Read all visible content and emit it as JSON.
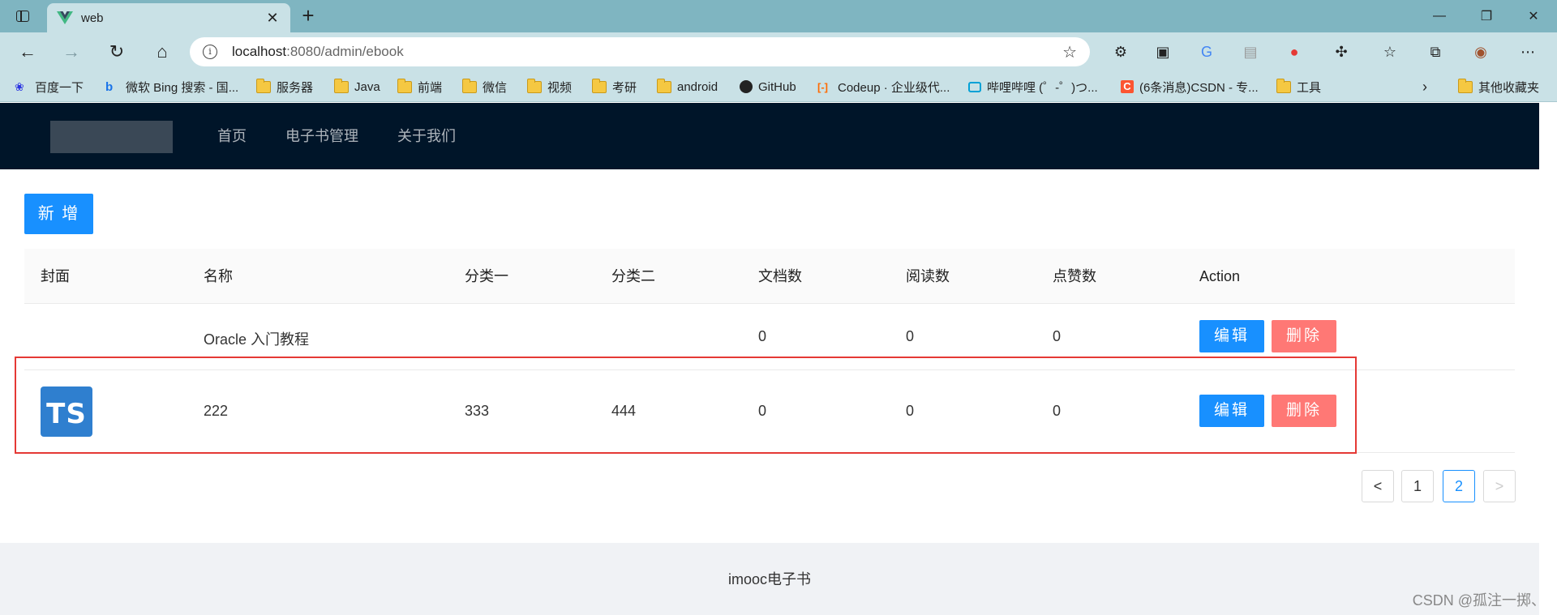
{
  "browser": {
    "tab_title": "web",
    "url_host": "localhost",
    "url_path": ":8080/admin/ebook",
    "bookmarks": [
      "百度一下",
      "微软 Bing 搜索 - 国...",
      "服务器",
      "Java",
      "前端",
      "微信",
      "视频",
      "考研",
      "android",
      "GitHub",
      "Codeup · 企业级代...",
      "哔哩哔哩 (゜-゜)つ...",
      "(6条消息)CSDN - 专...",
      "工具"
    ],
    "other_bookmarks": "其他收藏夹"
  },
  "header": {
    "menu": [
      "首页",
      "电子书管理",
      "关于我们"
    ]
  },
  "content": {
    "add_label": "新 增",
    "columns": [
      "封面",
      "名称",
      "分类一",
      "分类二",
      "文档数",
      "阅读数",
      "点赞数",
      "Action"
    ],
    "rows": [
      {
        "cover": "",
        "name": "Oracle 入门教程",
        "cat1": "",
        "cat2": "",
        "docs": "0",
        "views": "0",
        "likes": "0",
        "edit": "编辑",
        "del": "删除"
      },
      {
        "cover": "TS",
        "name": "222",
        "cat1": "333",
        "cat2": "444",
        "docs": "0",
        "views": "0",
        "likes": "0",
        "edit": "编辑",
        "del": "删除"
      }
    ]
  },
  "pagination": {
    "prev": "<",
    "pages": [
      "1",
      "2"
    ],
    "next": ">",
    "current": "2"
  },
  "footer": {
    "text": "imooc电子书"
  },
  "watermark": "CSDN @孤注一掷、",
  "colors": {
    "header_bg": "#001529",
    "primary": "#1890ff",
    "danger": "#ff7875",
    "highlight": "#e53935"
  }
}
